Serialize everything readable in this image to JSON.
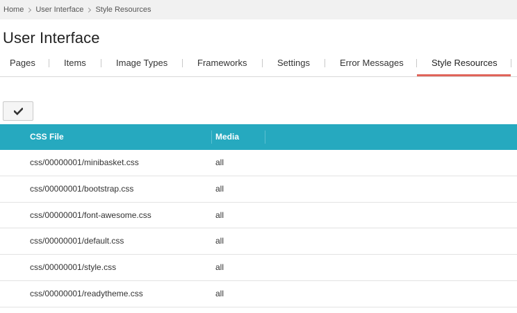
{
  "breadcrumb": [
    "Home",
    "User Interface",
    "Style Resources"
  ],
  "page_title": "User Interface",
  "tabs": [
    {
      "label": "Pages"
    },
    {
      "label": "Items"
    },
    {
      "label": "Image Types"
    },
    {
      "label": "Frameworks"
    },
    {
      "label": "Settings"
    },
    {
      "label": "Error Messages"
    },
    {
      "label": "Style Resources",
      "active": true
    }
  ],
  "toolbar": {
    "save_icon": "checkmark-icon"
  },
  "table": {
    "columns": [
      "CSS File",
      "Media"
    ],
    "rows": [
      [
        "css/00000001/minibasket.css",
        "all"
      ],
      [
        "css/00000001/bootstrap.css",
        "all"
      ],
      [
        "css/00000001/font-awesome.css",
        "all"
      ],
      [
        "css/00000001/default.css",
        "all"
      ],
      [
        "css/00000001/style.css",
        "all"
      ],
      [
        "css/00000001/readytheme.css",
        "all"
      ]
    ]
  },
  "colors": {
    "accent_tab_underline": "#e0645a",
    "table_header_bg": "#26a9bf",
    "breadcrumb_bg": "#f1f1f1"
  }
}
